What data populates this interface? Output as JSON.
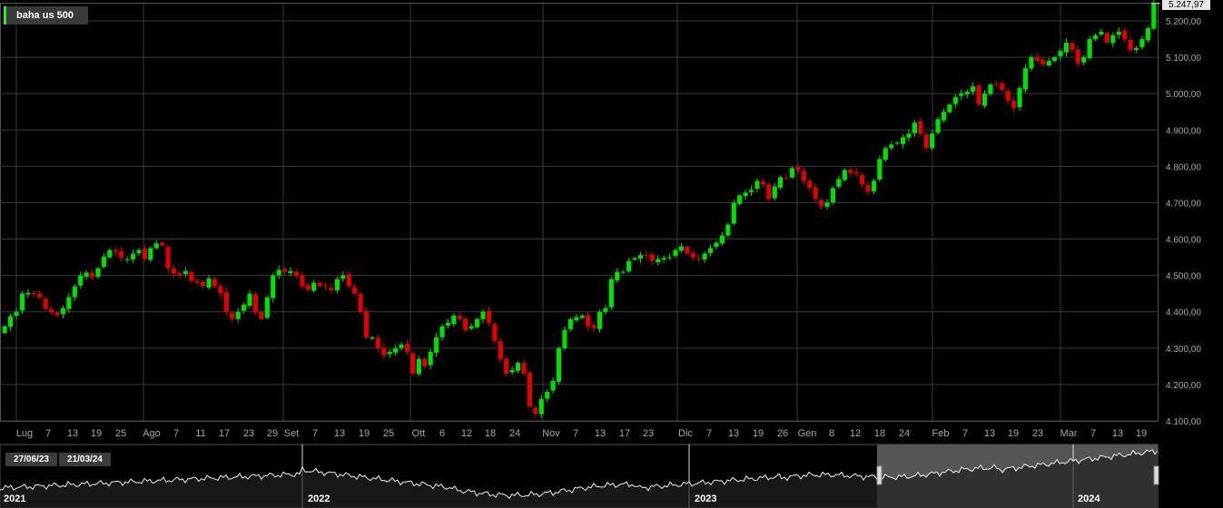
{
  "legend": {
    "label": "baha us 500",
    "color": "#2ee62e"
  },
  "last_price": "5.247,97",
  "colors": {
    "up": "#00e000",
    "down": "#e00000",
    "background": "#000000",
    "grid": "#3a3a3a",
    "axis_text": "#a8a8a8"
  },
  "overview": {
    "range_start": "27/06/23",
    "range_end": "21/03/24",
    "years": [
      "2021",
      "2022",
      "2023",
      "2024"
    ]
  },
  "chart_data": {
    "type": "candlestick",
    "title": "",
    "xlabel": "",
    "ylabel": "",
    "ylim": [
      4100,
      5260
    ],
    "y_ticks": [
      "4.100,00",
      "4.200,00",
      "4.300,00",
      "4.400,00",
      "4.500,00",
      "4.600,00",
      "4.700,00",
      "4.800,00",
      "4.900,00",
      "5.000,00",
      "5.100,00",
      "5.200,00"
    ],
    "x_ticks": [
      "Lug",
      "7",
      "13",
      "19",
      "25",
      "Ago",
      "7",
      "11",
      "17",
      "23",
      "29",
      "Set",
      "7",
      "13",
      "19",
      "25",
      "Ott",
      "6",
      "12",
      "18",
      "24",
      "Nov",
      "7",
      "13",
      "17",
      "23",
      "Dic",
      "7",
      "13",
      "19",
      "26",
      "Gen",
      "8",
      "12",
      "18",
      "24",
      "Feb",
      "7",
      "13",
      "19",
      "23",
      "Mar",
      "7",
      "13",
      "19"
    ],
    "month_ticks": [
      "Lug",
      "Ago",
      "Set",
      "Ott",
      "Nov",
      "Dic",
      "Gen",
      "Feb",
      "Mar"
    ],
    "close": [
      4360,
      4388,
      4400,
      4450,
      4452,
      4448,
      4440,
      4408,
      4398,
      4390,
      4410,
      4440,
      4470,
      4500,
      4508,
      4495,
      4520,
      4552,
      4570,
      4565,
      4548,
      4545,
      4560,
      4570,
      4545,
      4575,
      4588,
      4582,
      4520,
      4505,
      4500,
      4512,
      4485,
      4480,
      4470,
      4492,
      4470,
      4450,
      4400,
      4380,
      4400,
      4420,
      4450,
      4398,
      4380,
      4440,
      4500,
      4515,
      4510,
      4512,
      4500,
      4470,
      4460,
      4480,
      4470,
      4470,
      4460,
      4490,
      4500,
      4470,
      4450,
      4400,
      4330,
      4330,
      4300,
      4280,
      4290,
      4300,
      4310,
      4290,
      4230,
      4270,
      4250,
      4290,
      4330,
      4360,
      4370,
      4390,
      4380,
      4350,
      4360,
      4380,
      4400,
      4370,
      4320,
      4270,
      4230,
      4240,
      4260,
      4230,
      4140,
      4120,
      4160,
      4180,
      4210,
      4300,
      4350,
      4380,
      4385,
      4390,
      4360,
      4355,
      4400,
      4410,
      4490,
      4510,
      4510,
      4540,
      4548,
      4556,
      4555,
      4540,
      4545,
      4548,
      4550,
      4570,
      4580,
      4560,
      4550,
      4545,
      4560,
      4575,
      4590,
      4610,
      4640,
      4700,
      4720,
      4728,
      4735,
      4760,
      4750,
      4710,
      4745,
      4770,
      4768,
      4795,
      4790,
      4760,
      4740,
      4710,
      4690,
      4700,
      4740,
      4765,
      4790,
      4782,
      4780,
      4750,
      4730,
      4760,
      4820,
      4850,
      4860,
      4865,
      4880,
      4890,
      4920,
      4890,
      4850,
      4890,
      4930,
      4950,
      4970,
      4990,
      5000,
      5005,
      5020,
      4970,
      5000,
      5025,
      5025,
      5010,
      4980,
      4960,
      5015,
      5070,
      5100,
      5090,
      5080,
      5090,
      5100,
      5117,
      5140,
      5120,
      5082,
      5100,
      5150,
      5160,
      5170,
      5140,
      5160,
      5170,
      5150,
      5120,
      5125,
      5150,
      5180,
      5248
    ]
  }
}
